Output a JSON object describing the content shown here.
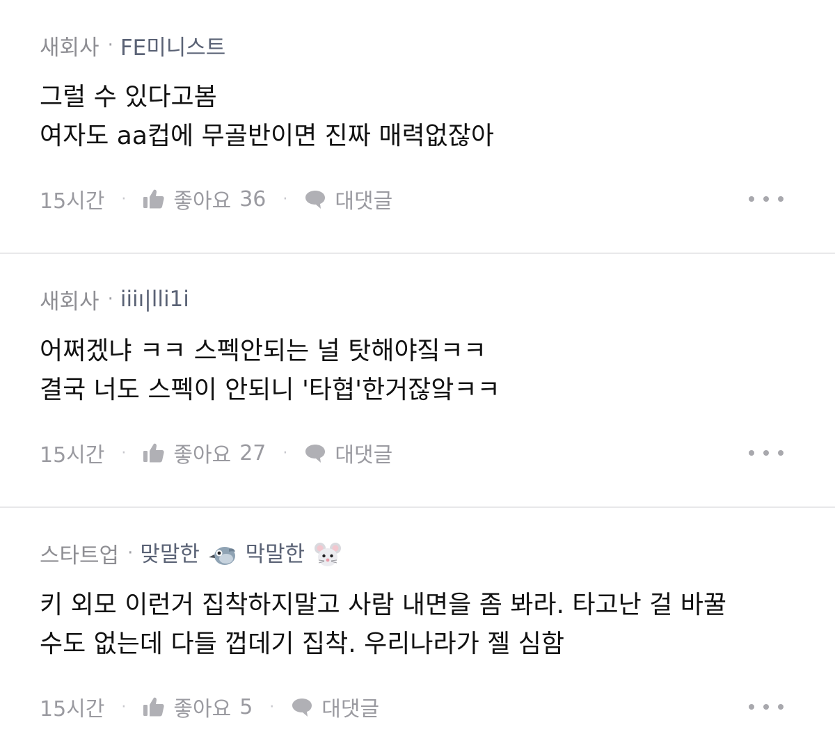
{
  "comments": [
    {
      "company": "새회사",
      "nickname": "FE미니스트",
      "lines": [
        "그럴 수 있다고봄",
        "여자도 aa컵에 무골반이면 진짜 매력없잖아"
      ],
      "time": "15시간",
      "like_label": "좋아요",
      "like_count": "36",
      "reply_label": "대댓글"
    },
    {
      "company": "새회사",
      "nickname": "iiiı|lli1i",
      "lines": [
        "어쩌겠냐 ㅋㅋ 스펙안되는 널 탓해야짘ㅋㅋ",
        "결국 너도 스펙이 안되니 '타협'한거잖앜ㅋㅋ"
      ],
      "time": "15시간",
      "like_label": "좋아요",
      "like_count": "27",
      "reply_label": "대댓글"
    },
    {
      "company": "스타트업",
      "nickname_parts": [
        "맞말한",
        "막말한"
      ],
      "emoji_icons": [
        "bird-emoji-icon",
        "mouse-emoji-icon"
      ],
      "lines": [
        "키 외모 이런거 집착하지말고 사람 내면을 좀 봐라. 타고난 걸 바꿀",
        "수도 없는데 다들 껍데기 집착. 우리나라가 젤 심함"
      ],
      "time": "15시간",
      "like_label": "좋아요",
      "like_count": "5",
      "reply_label": "대댓글"
    }
  ],
  "separator": "·",
  "icons": {
    "like": "thumbs-up-icon",
    "reply": "speech-bubble-icon",
    "more": "more-dots-icon"
  },
  "colors": {
    "meta_gray": "#8e8e93",
    "nickname": "#5a6275",
    "action_gray": "#9a9aa0",
    "divider": "#e8e8ea"
  }
}
